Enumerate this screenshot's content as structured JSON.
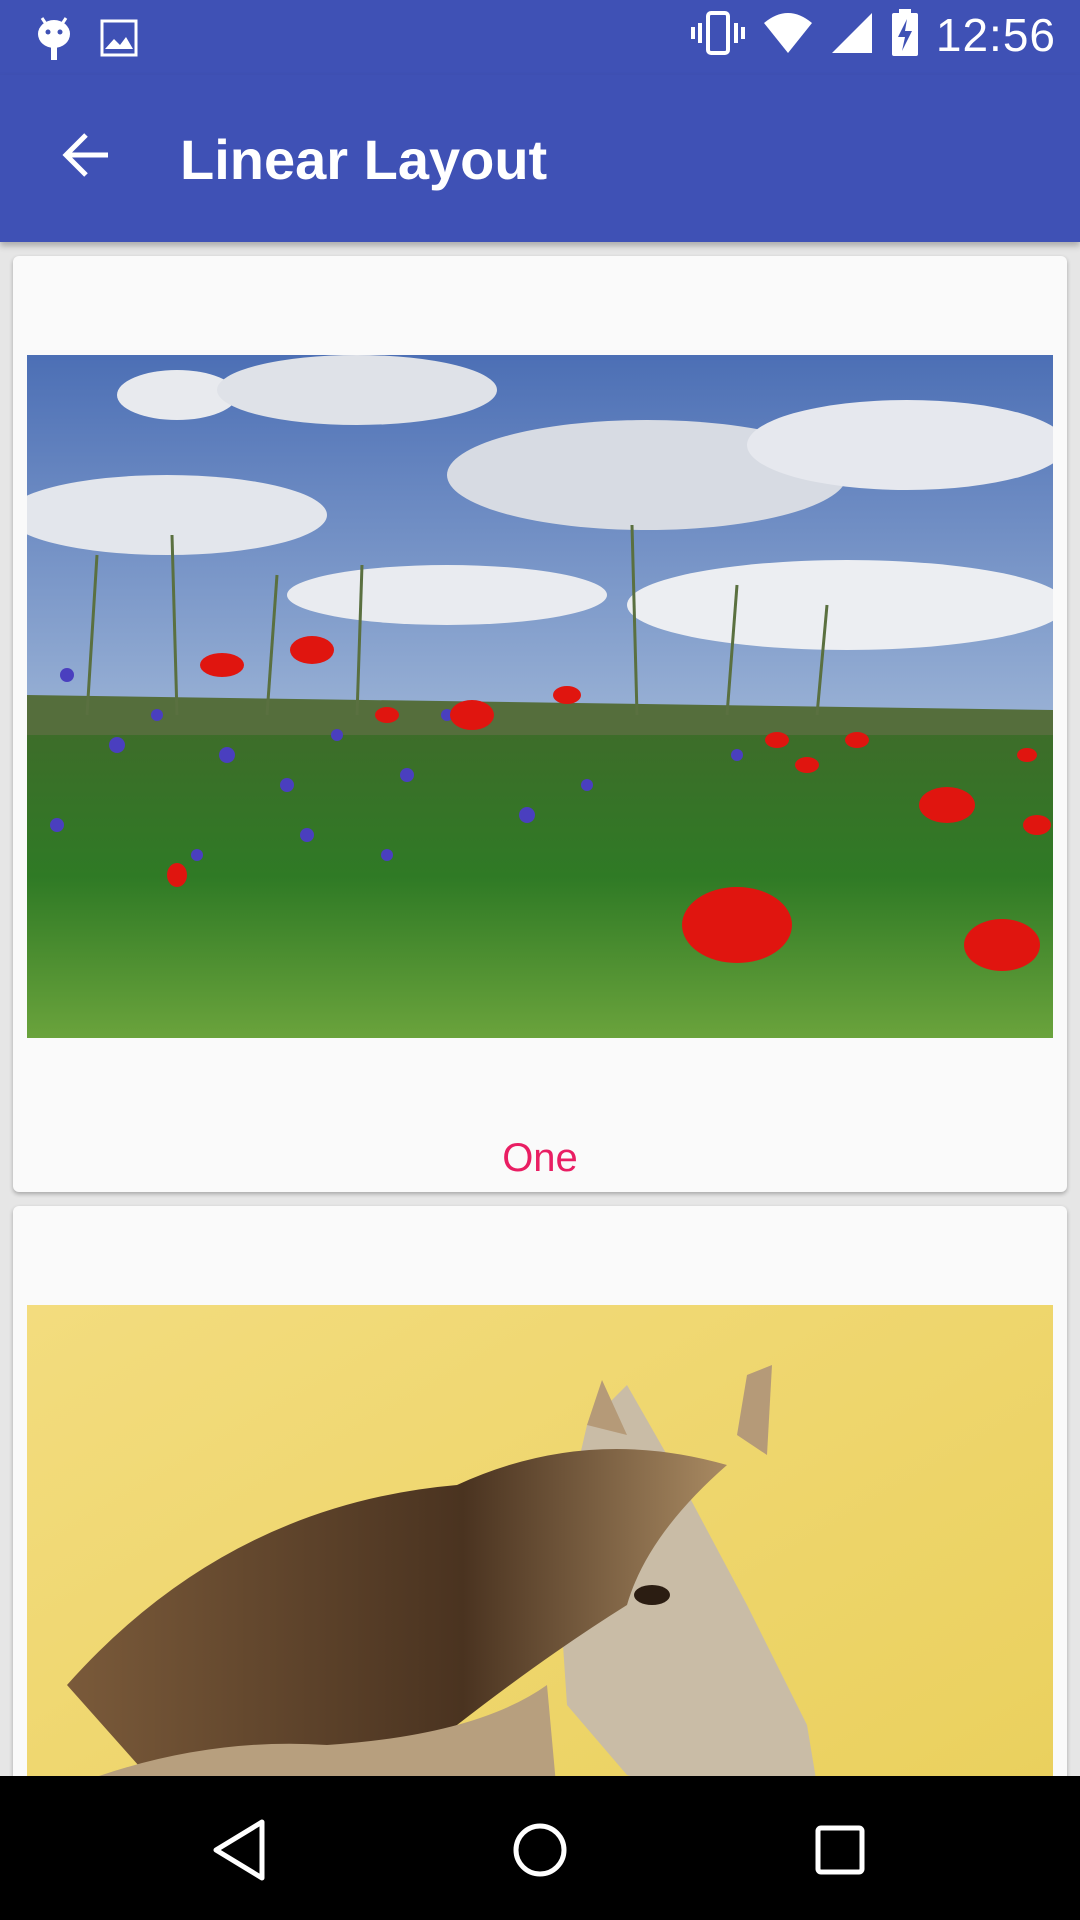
{
  "status_bar": {
    "time": "12:56",
    "left_icons": [
      "android-icon",
      "image-icon"
    ],
    "right_icons": [
      "vibrate-icon",
      "wifi-icon",
      "signal-icon",
      "battery-charging-icon"
    ]
  },
  "app_bar": {
    "title": "Linear Layout",
    "back_icon": "arrow-back-icon"
  },
  "cards": [
    {
      "image": "flower-field-image",
      "label": "One"
    },
    {
      "image": "horse-image",
      "label": ""
    }
  ],
  "nav_bar": {
    "buttons": [
      "back-triangle-icon",
      "home-circle-icon",
      "recents-square-icon"
    ]
  },
  "colors": {
    "primary": "#3f51b5",
    "accent": "#e91e63",
    "card_bg": "#fafafa",
    "nav_bg": "#000000"
  }
}
